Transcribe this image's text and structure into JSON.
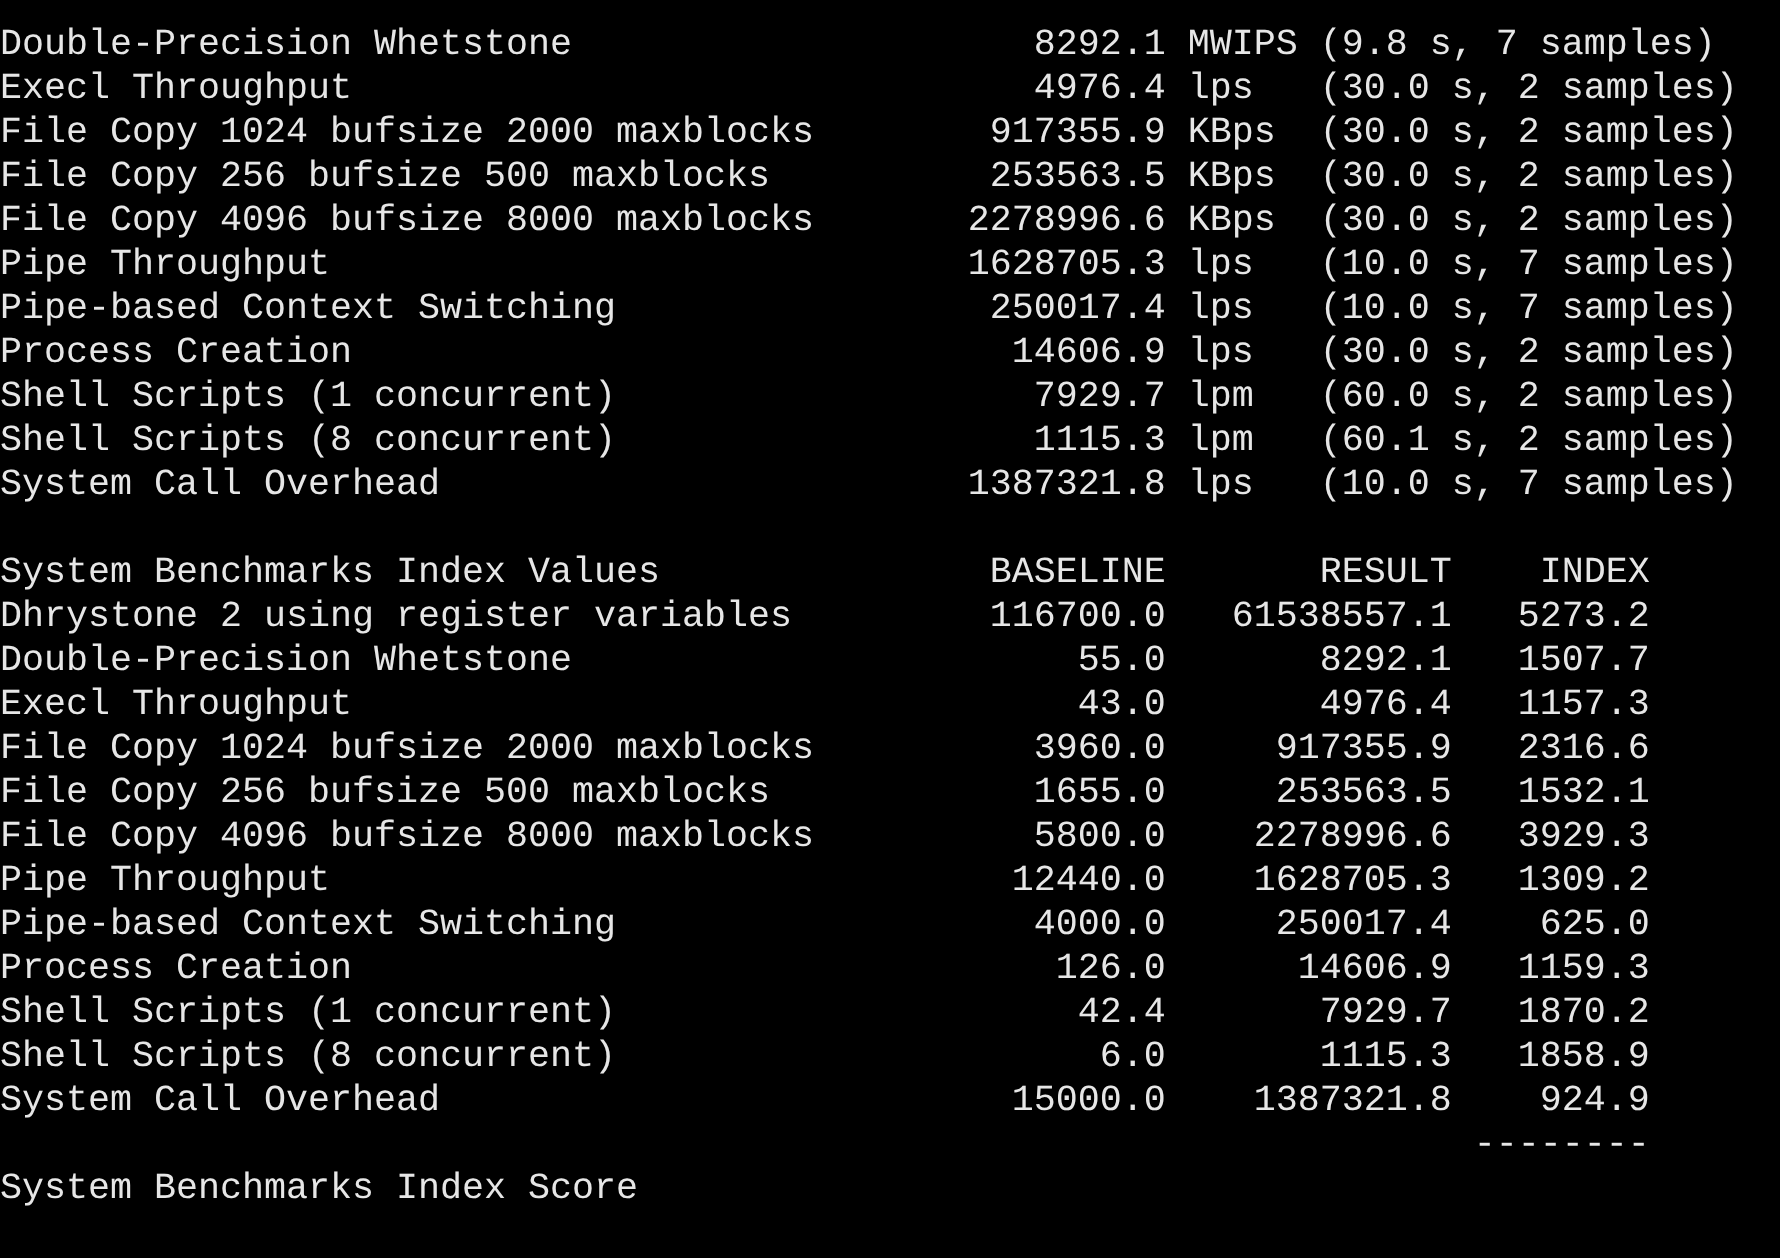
{
  "raw_results": [
    {
      "name": "Double-Precision Whetstone",
      "value": "8292.1",
      "unit": "MWIPS",
      "timing": "(9.8 s, 7 samples)"
    },
    {
      "name": "Execl Throughput",
      "value": "4976.4",
      "unit": "lps",
      "timing": "(30.0 s, 2 samples)"
    },
    {
      "name": "File Copy 1024 bufsize 2000 maxblocks",
      "value": "917355.9",
      "unit": "KBps",
      "timing": "(30.0 s, 2 samples)"
    },
    {
      "name": "File Copy 256 bufsize 500 maxblocks",
      "value": "253563.5",
      "unit": "KBps",
      "timing": "(30.0 s, 2 samples)"
    },
    {
      "name": "File Copy 4096 bufsize 8000 maxblocks",
      "value": "2278996.6",
      "unit": "KBps",
      "timing": "(30.0 s, 2 samples)"
    },
    {
      "name": "Pipe Throughput",
      "value": "1628705.3",
      "unit": "lps",
      "timing": "(10.0 s, 7 samples)"
    },
    {
      "name": "Pipe-based Context Switching",
      "value": "250017.4",
      "unit": "lps",
      "timing": "(10.0 s, 7 samples)"
    },
    {
      "name": "Process Creation",
      "value": "14606.9",
      "unit": "lps",
      "timing": "(30.0 s, 2 samples)"
    },
    {
      "name": "Shell Scripts (1 concurrent)",
      "value": "7929.7",
      "unit": "lpm",
      "timing": "(60.0 s, 2 samples)"
    },
    {
      "name": "Shell Scripts (8 concurrent)",
      "value": "1115.3",
      "unit": "lpm",
      "timing": "(60.1 s, 2 samples)"
    },
    {
      "name": "System Call Overhead",
      "value": "1387321.8",
      "unit": "lps",
      "timing": "(10.0 s, 7 samples)"
    }
  ],
  "index_table": {
    "columns": [
      "System Benchmarks Index Values",
      "BASELINE",
      "RESULT",
      "INDEX"
    ],
    "rows": [
      [
        "Dhrystone 2 using register variables",
        "116700.0",
        "61538557.1",
        "5273.2"
      ],
      [
        "Double-Precision Whetstone",
        "55.0",
        "8292.1",
        "1507.7"
      ],
      [
        "Execl Throughput",
        "43.0",
        "4976.4",
        "1157.3"
      ],
      [
        "File Copy 1024 bufsize 2000 maxblocks",
        "3960.0",
        "917355.9",
        "2316.6"
      ],
      [
        "File Copy 256 bufsize 500 maxblocks",
        "1655.0",
        "253563.5",
        "1532.1"
      ],
      [
        "File Copy 4096 bufsize 8000 maxblocks",
        "5800.0",
        "2278996.6",
        "3929.3"
      ],
      [
        "Pipe Throughput",
        "12440.0",
        "1628705.3",
        "1309.2"
      ],
      [
        "Pipe-based Context Switching",
        "4000.0",
        "250017.4",
        "625.0"
      ],
      [
        "Process Creation",
        "126.0",
        "14606.9",
        "1159.3"
      ],
      [
        "Shell Scripts (1 concurrent)",
        "42.4",
        "7929.7",
        "1870.2"
      ],
      [
        "Shell Scripts (8 concurrent)",
        "6.0",
        "1115.3",
        "1858.9"
      ],
      [
        "System Call Overhead",
        "15000.0",
        "1387321.8",
        "924.9"
      ]
    ],
    "separator": "--------",
    "score_label": "System Benchmarks Index Score"
  }
}
